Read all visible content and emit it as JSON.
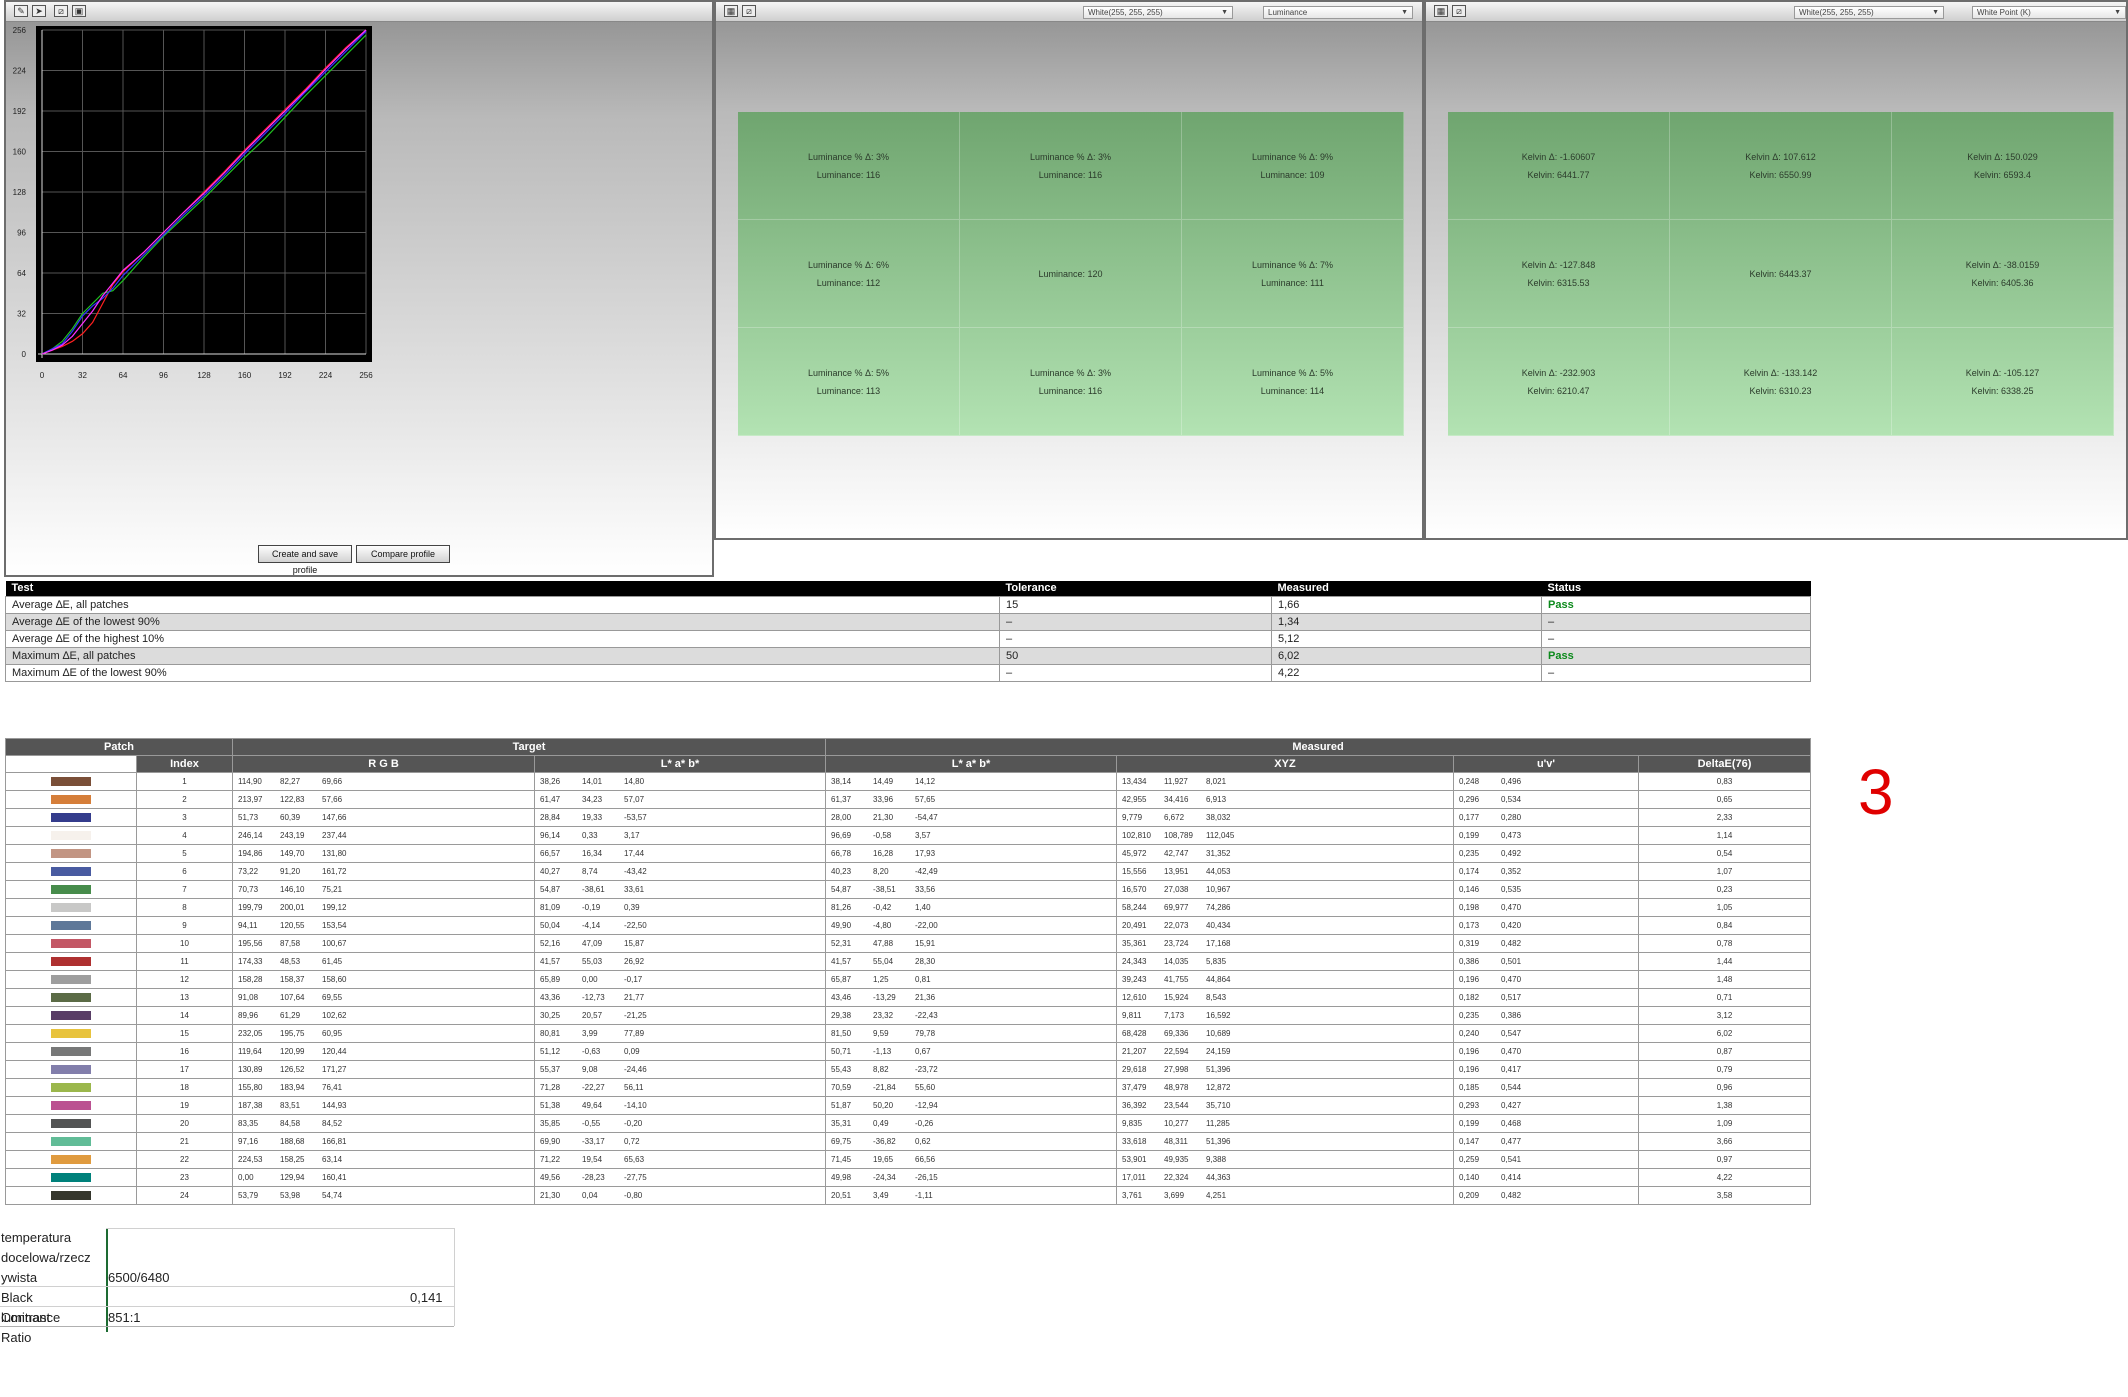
{
  "chart_panel": {
    "toolbar_icons": [
      "pen-icon",
      "cursor-icon",
      "edit-icon",
      "image-icon"
    ],
    "buttons": {
      "create": "Create and save profile",
      "compare": "Compare profile"
    }
  },
  "chart_data": {
    "type": "line",
    "xlim": [
      0,
      256
    ],
    "ylim": [
      0,
      256
    ],
    "x_ticks": [
      "0",
      "32",
      "64",
      "96",
      "128",
      "160",
      "192",
      "224",
      "256"
    ],
    "y_ticks": [
      "256",
      "224",
      "192",
      "160",
      "128",
      "96",
      "64",
      "32",
      "0"
    ],
    "grid": true,
    "series": [
      {
        "color": "#ff2020",
        "x": [
          0,
          8,
          16,
          24,
          32,
          40,
          48,
          56,
          64,
          80,
          96,
          112,
          128,
          144,
          160,
          176,
          192,
          208,
          224,
          240,
          256
        ],
        "y": [
          0,
          3,
          6,
          10,
          16,
          25,
          40,
          55,
          65,
          80,
          96,
          112,
          128,
          144,
          161,
          177,
          193,
          209,
          226,
          242,
          258
        ]
      },
      {
        "color": "#20c020",
        "x": [
          0,
          8,
          16,
          24,
          32,
          40,
          48,
          56,
          64,
          80,
          96,
          112,
          128,
          144,
          160,
          176,
          192,
          208,
          224,
          240,
          256
        ],
        "y": [
          0,
          4,
          10,
          20,
          32,
          40,
          48,
          50,
          58,
          76,
          93,
          108,
          123,
          139,
          155,
          170,
          187,
          204,
          220,
          236,
          252
        ]
      },
      {
        "color": "#3333ff",
        "x": [
          0,
          8,
          16,
          24,
          32,
          40,
          48,
          56,
          64,
          80,
          96,
          112,
          128,
          144,
          160,
          176,
          192,
          208,
          224,
          240,
          256
        ],
        "y": [
          0,
          4,
          8,
          18,
          30,
          38,
          44,
          52,
          62,
          78,
          94,
          110,
          125,
          141,
          158,
          174,
          190,
          207,
          223,
          239,
          255
        ]
      },
      {
        "color": "#ff30ff",
        "x": [
          0,
          8,
          16,
          24,
          32,
          40,
          48,
          56,
          64,
          80,
          96,
          112,
          128,
          144,
          160,
          176,
          192,
          208,
          224,
          240,
          256
        ],
        "y": [
          0,
          3,
          7,
          14,
          24,
          34,
          46,
          56,
          66,
          80,
          96,
          112,
          127,
          143,
          160,
          176,
          192,
          208,
          225,
          241,
          257
        ]
      }
    ]
  },
  "luminance_panel": {
    "dropdowns": [
      "White(255, 255, 255)",
      "Luminance"
    ],
    "cells": [
      {
        "a": "Luminance % Δ:  3%",
        "b": "Luminance:  116"
      },
      {
        "a": "Luminance % Δ:  3%",
        "b": "Luminance:  116"
      },
      {
        "a": "Luminance % Δ:  9%",
        "b": "Luminance:  109"
      },
      {
        "a": "Luminance % Δ:  6%",
        "b": "Luminance:  112"
      },
      {
        "a": "",
        "b": "Luminance:  120"
      },
      {
        "a": "Luminance % Δ:  7%",
        "b": "Luminance:  111"
      },
      {
        "a": "Luminance % Δ:  5%",
        "b": "Luminance:  113"
      },
      {
        "a": "Luminance % Δ:  3%",
        "b": "Luminance:  116"
      },
      {
        "a": "Luminance % Δ:  5%",
        "b": "Luminance:  114"
      }
    ]
  },
  "kelvin_panel": {
    "dropdowns": [
      "White(255, 255, 255)",
      "White Point (K)"
    ],
    "cells": [
      {
        "a": "Kelvin Δ:  -1.60607",
        "b": "Kelvin:  6441.77"
      },
      {
        "a": "Kelvin Δ:  107.612",
        "b": "Kelvin:  6550.99"
      },
      {
        "a": "Kelvin Δ:  150.029",
        "b": "Kelvin:  6593.4"
      },
      {
        "a": "Kelvin Δ:  -127.848",
        "b": "Kelvin:  6315.53"
      },
      {
        "a": "",
        "b": "Kelvin:  6443.37"
      },
      {
        "a": "Kelvin Δ:  -38.0159",
        "b": "Kelvin:  6405.36"
      },
      {
        "a": "Kelvin Δ:  -232.903",
        "b": "Kelvin:  6210.47"
      },
      {
        "a": "Kelvin Δ:  -133.142",
        "b": "Kelvin:  6310.23"
      },
      {
        "a": "Kelvin Δ:  -105.127",
        "b": "Kelvin:  6338.25"
      }
    ]
  },
  "summary": {
    "headers": [
      "Test",
      "Tolerance",
      "Measured",
      "Status"
    ],
    "rows": [
      [
        "Average ∆E, all patches",
        "15",
        "1,66",
        "Pass"
      ],
      [
        "Average ∆E of the lowest 90%",
        "–",
        "1,34",
        "–"
      ],
      [
        "Average ∆E of the highest 10%",
        "–",
        "5,12",
        "–"
      ],
      [
        "Maximum ∆E, all patches",
        "50",
        "6,02",
        "Pass"
      ],
      [
        "Maximum ∆E of the lowest 90%",
        "–",
        "4,22",
        "–"
      ]
    ]
  },
  "patches": {
    "group_headers": [
      "Patch",
      "Target",
      "Measured"
    ],
    "sub_headers": [
      "Index",
      "R G B",
      "L* a* b*",
      "L* a* b*",
      "XYZ",
      "u'v'",
      "DeltaE(76)"
    ],
    "rows": [
      {
        "color": "#7a4f38",
        "index": "1",
        "rgb": [
          "114,90",
          "82,27",
          "69,66"
        ],
        "tlab": [
          "38,26",
          "14,01",
          "14,80"
        ],
        "mlab": [
          "38,14",
          "14,49",
          "14,12"
        ],
        "xyz": [
          "13,434",
          "11,927",
          "8,021"
        ],
        "uv": [
          "0,248",
          "0,496"
        ],
        "de": "0,83"
      },
      {
        "color": "#d57e3a",
        "index": "2",
        "rgb": [
          "213,97",
          "122,83",
          "57,66"
        ],
        "tlab": [
          "61,47",
          "34,23",
          "57,07"
        ],
        "mlab": [
          "61,37",
          "33,96",
          "57,65"
        ],
        "xyz": [
          "42,955",
          "34,416",
          "6,913"
        ],
        "uv": [
          "0,296",
          "0,534"
        ],
        "de": "0,65"
      },
      {
        "color": "#343c8c",
        "index": "3",
        "rgb": [
          "51,73",
          "60,39",
          "147,66"
        ],
        "tlab": [
          "28,84",
          "19,33",
          "-53,57"
        ],
        "mlab": [
          "28,00",
          "21,30",
          "-54,47"
        ],
        "xyz": [
          "9,779",
          "6,672",
          "38,032"
        ],
        "uv": [
          "0,177",
          "0,280"
        ],
        "de": "2,33"
      },
      {
        "color": "#f6f1ec",
        "index": "4",
        "rgb": [
          "246,14",
          "243,19",
          "237,44"
        ],
        "tlab": [
          "96,14",
          "0,33",
          "3,17"
        ],
        "mlab": [
          "96,69",
          "-0,58",
          "3,57"
        ],
        "xyz": [
          "102,810",
          "108,789",
          "112,045"
        ],
        "uv": [
          "0,199",
          "0,473"
        ],
        "de": "1,14"
      },
      {
        "color": "#c29583",
        "index": "5",
        "rgb": [
          "194,86",
          "149,70",
          "131,80"
        ],
        "tlab": [
          "66,57",
          "16,34",
          "17,44"
        ],
        "mlab": [
          "66,78",
          "16,28",
          "17,93"
        ],
        "xyz": [
          "45,972",
          "42,747",
          "31,352"
        ],
        "uv": [
          "0,235",
          "0,492"
        ],
        "de": "0,54"
      },
      {
        "color": "#495ba1",
        "index": "6",
        "rgb": [
          "73,22",
          "91,20",
          "161,72"
        ],
        "tlab": [
          "40,27",
          "8,74",
          "-43,42"
        ],
        "mlab": [
          "40,23",
          "8,20",
          "-42,49"
        ],
        "xyz": [
          "15,556",
          "13,951",
          "44,053"
        ],
        "uv": [
          "0,174",
          "0,352"
        ],
        "de": "1,07"
      },
      {
        "color": "#478c4b",
        "index": "7",
        "rgb": [
          "70,73",
          "146,10",
          "75,21"
        ],
        "tlab": [
          "54,87",
          "-38,61",
          "33,61"
        ],
        "mlab": [
          "54,87",
          "-38,51",
          "33,56"
        ],
        "xyz": [
          "16,570",
          "27,038",
          "10,967"
        ],
        "uv": [
          "0,146",
          "0,535"
        ],
        "de": "0,23"
      },
      {
        "color": "#c8c8c7",
        "index": "8",
        "rgb": [
          "199,79",
          "200,01",
          "199,12"
        ],
        "tlab": [
          "81,09",
          "-0,19",
          "0,39"
        ],
        "mlab": [
          "81,26",
          "-0,42",
          "1,40"
        ],
        "xyz": [
          "58,244",
          "69,977",
          "74,286"
        ],
        "uv": [
          "0,198",
          "0,470"
        ],
        "de": "1,05"
      },
      {
        "color": "#5e7899",
        "index": "9",
        "rgb": [
          "94,11",
          "120,55",
          "153,54"
        ],
        "tlab": [
          "50,04",
          "-4,14",
          "-22,50"
        ],
        "mlab": [
          "49,90",
          "-4,80",
          "-22,00"
        ],
        "xyz": [
          "20,491",
          "22,073",
          "40,434"
        ],
        "uv": [
          "0,173",
          "0,420"
        ],
        "de": "0,84"
      },
      {
        "color": "#c35765",
        "index": "10",
        "rgb": [
          "195,56",
          "87,58",
          "100,67"
        ],
        "tlab": [
          "52,16",
          "47,09",
          "15,87"
        ],
        "mlab": [
          "52,31",
          "47,88",
          "15,91"
        ],
        "xyz": [
          "35,361",
          "23,724",
          "17,168"
        ],
        "uv": [
          "0,319",
          "0,482"
        ],
        "de": "0,78"
      },
      {
        "color": "#ae3030",
        "index": "11",
        "rgb": [
          "174,33",
          "48,53",
          "61,45"
        ],
        "tlab": [
          "41,57",
          "55,03",
          "26,92"
        ],
        "mlab": [
          "41,57",
          "55,04",
          "28,30"
        ],
        "xyz": [
          "24,343",
          "14,035",
          "5,835"
        ],
        "uv": [
          "0,386",
          "0,501"
        ],
        "de": "1,44"
      },
      {
        "color": "#9e9e9e",
        "index": "12",
        "rgb": [
          "158,28",
          "158,37",
          "158,60"
        ],
        "tlab": [
          "65,89",
          "0,00",
          "-0,17"
        ],
        "mlab": [
          "65,87",
          "1,25",
          "0,81"
        ],
        "xyz": [
          "39,243",
          "41,755",
          "44,864"
        ],
        "uv": [
          "0,196",
          "0,470"
        ],
        "de": "1,48"
      },
      {
        "color": "#5b6b46",
        "index": "13",
        "rgb": [
          "91,08",
          "107,64",
          "69,55"
        ],
        "tlab": [
          "43,36",
          "-12,73",
          "21,77"
        ],
        "mlab": [
          "43,46",
          "-13,29",
          "21,36"
        ],
        "xyz": [
          "12,610",
          "15,924",
          "8,543"
        ],
        "uv": [
          "0,182",
          "0,517"
        ],
        "de": "0,71"
      },
      {
        "color": "#593d66",
        "index": "14",
        "rgb": [
          "89,96",
          "61,29",
          "102,62"
        ],
        "tlab": [
          "30,25",
          "20,57",
          "-21,25"
        ],
        "mlab": [
          "29,38",
          "23,32",
          "-22,43"
        ],
        "xyz": [
          "9,811",
          "7,173",
          "16,592"
        ],
        "uv": [
          "0,235",
          "0,386"
        ],
        "de": "3,12"
      },
      {
        "color": "#e8c33d",
        "index": "15",
        "rgb": [
          "232,05",
          "195,75",
          "60,95"
        ],
        "tlab": [
          "80,81",
          "3,99",
          "77,89"
        ],
        "mlab": [
          "81,50",
          "9,59",
          "79,78"
        ],
        "xyz": [
          "68,428",
          "69,336",
          "10,689"
        ],
        "uv": [
          "0,240",
          "0,547"
        ],
        "de": "6,02"
      },
      {
        "color": "#777878",
        "index": "16",
        "rgb": [
          "119,64",
          "120,99",
          "120,44"
        ],
        "tlab": [
          "51,12",
          "-0,63",
          "0,09"
        ],
        "mlab": [
          "50,71",
          "-1,13",
          "0,67"
        ],
        "xyz": [
          "21,207",
          "22,594",
          "24,159"
        ],
        "uv": [
          "0,196",
          "0,470"
        ],
        "de": "0,87"
      },
      {
        "color": "#827eab",
        "index": "17",
        "rgb": [
          "130,89",
          "126,52",
          "171,27"
        ],
        "tlab": [
          "55,37",
          "9,08",
          "-24,46"
        ],
        "mlab": [
          "55,43",
          "8,82",
          "-23,72"
        ],
        "xyz": [
          "29,618",
          "27,998",
          "51,396"
        ],
        "uv": [
          "0,196",
          "0,417"
        ],
        "de": "0,79"
      },
      {
        "color": "#9bb74c",
        "index": "18",
        "rgb": [
          "155,80",
          "183,94",
          "76,41"
        ],
        "tlab": [
          "71,28",
          "-22,27",
          "56,11"
        ],
        "mlab": [
          "70,59",
          "-21,84",
          "55,60"
        ],
        "xyz": [
          "37,479",
          "48,978",
          "12,872"
        ],
        "uv": [
          "0,185",
          "0,544"
        ],
        "de": "0,96"
      },
      {
        "color": "#bb5191",
        "index": "19",
        "rgb": [
          "187,38",
          "83,51",
          "144,93"
        ],
        "tlab": [
          "51,38",
          "49,64",
          "-14,10"
        ],
        "mlab": [
          "51,87",
          "50,20",
          "-12,94"
        ],
        "xyz": [
          "36,392",
          "23,544",
          "35,710"
        ],
        "uv": [
          "0,293",
          "0,427"
        ],
        "de": "1,38"
      },
      {
        "color": "#535454",
        "index": "20",
        "rgb": [
          "83,35",
          "84,58",
          "84,52"
        ],
        "tlab": [
          "35,85",
          "-0,55",
          "-0,20"
        ],
        "mlab": [
          "35,31",
          "0,49",
          "-0,26"
        ],
        "xyz": [
          "9,835",
          "10,277",
          "11,285"
        ],
        "uv": [
          "0,199",
          "0,468"
        ],
        "de": "1,09"
      },
      {
        "color": "#61bc97",
        "index": "21",
        "rgb": [
          "97,16",
          "188,68",
          "166,81"
        ],
        "tlab": [
          "69,90",
          "-33,17",
          "0,72"
        ],
        "mlab": [
          "69,75",
          "-36,82",
          "0,62"
        ],
        "xyz": [
          "33,618",
          "48,311",
          "51,396"
        ],
        "uv": [
          "0,147",
          "0,477"
        ],
        "de": "3,66"
      },
      {
        "color": "#e09b3f",
        "index": "22",
        "rgb": [
          "224,53",
          "158,25",
          "63,14"
        ],
        "tlab": [
          "71,22",
          "19,54",
          "65,63"
        ],
        "mlab": [
          "71,45",
          "19,65",
          "66,56"
        ],
        "xyz": [
          "53,901",
          "49,935",
          "9,388"
        ],
        "uv": [
          "0,259",
          "0,541"
        ],
        "de": "0,97"
      },
      {
        "color": "#00817b",
        "index": "23",
        "rgb": [
          "0,00",
          "129,94",
          "160,41"
        ],
        "tlab": [
          "49,56",
          "-28,23",
          "-27,75"
        ],
        "mlab": [
          "49,98",
          "-24,34",
          "-26,15"
        ],
        "xyz": [
          "17,011",
          "22,324",
          "44,363"
        ],
        "uv": [
          "0,140",
          "0,414"
        ],
        "de": "4,22"
      },
      {
        "color": "#35362c",
        "index": "24",
        "rgb": [
          "53,79",
          "53,98",
          "54,74"
        ],
        "tlab": [
          "21,30",
          "0,04",
          "-0,80"
        ],
        "mlab": [
          "20,51",
          "3,49",
          "-1,11"
        ],
        "xyz": [
          "3,761",
          "3,699",
          "4,251"
        ],
        "uv": [
          "0,209",
          "0,482"
        ],
        "de": "3,58"
      }
    ]
  },
  "bottom": {
    "label_1": "temperatura",
    "label_2": "docelowa/rzecz",
    "label_3": "ywista",
    "value_temp": "6500/6480",
    "label_black": "Black luminance",
    "value_black": "0,141",
    "label_contrast": "Contrast Ratio",
    "value_contrast": "851:1"
  },
  "marker": "3"
}
